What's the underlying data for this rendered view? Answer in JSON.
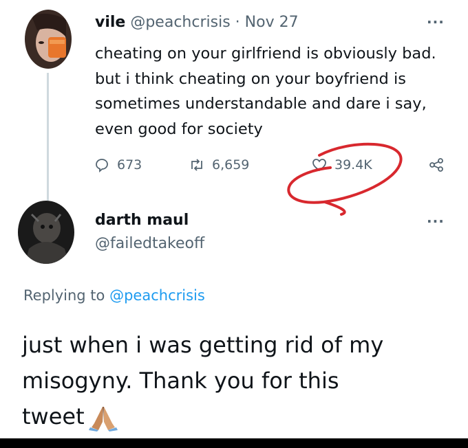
{
  "original_tweet": {
    "author_name": "vile",
    "author_handle": "@peachcrisis",
    "separator": "·",
    "date": "Nov 27",
    "more": "···",
    "lines": [
      "cheating on your girlfriend is obviously bad.",
      "but i think cheating on your boyfriend is",
      "sometimes understandable and dare i say,",
      "even good for society"
    ],
    "replies": "673",
    "retweets": "6,659",
    "likes": "39.4K"
  },
  "reply_tweet": {
    "author_name": "darth maul",
    "author_handle": "@failedtakeoff",
    "more": "···",
    "replying_prefix": "Replying to",
    "replying_mention": "@peachcrisis",
    "lines": [
      "just when i was getting rid of my",
      "misogyny. Thank you for this",
      "tweet"
    ]
  },
  "colors": {
    "text": "#0f1419",
    "muted": "#536471",
    "link": "#1d9bf0",
    "annotation": "#d8282e"
  }
}
